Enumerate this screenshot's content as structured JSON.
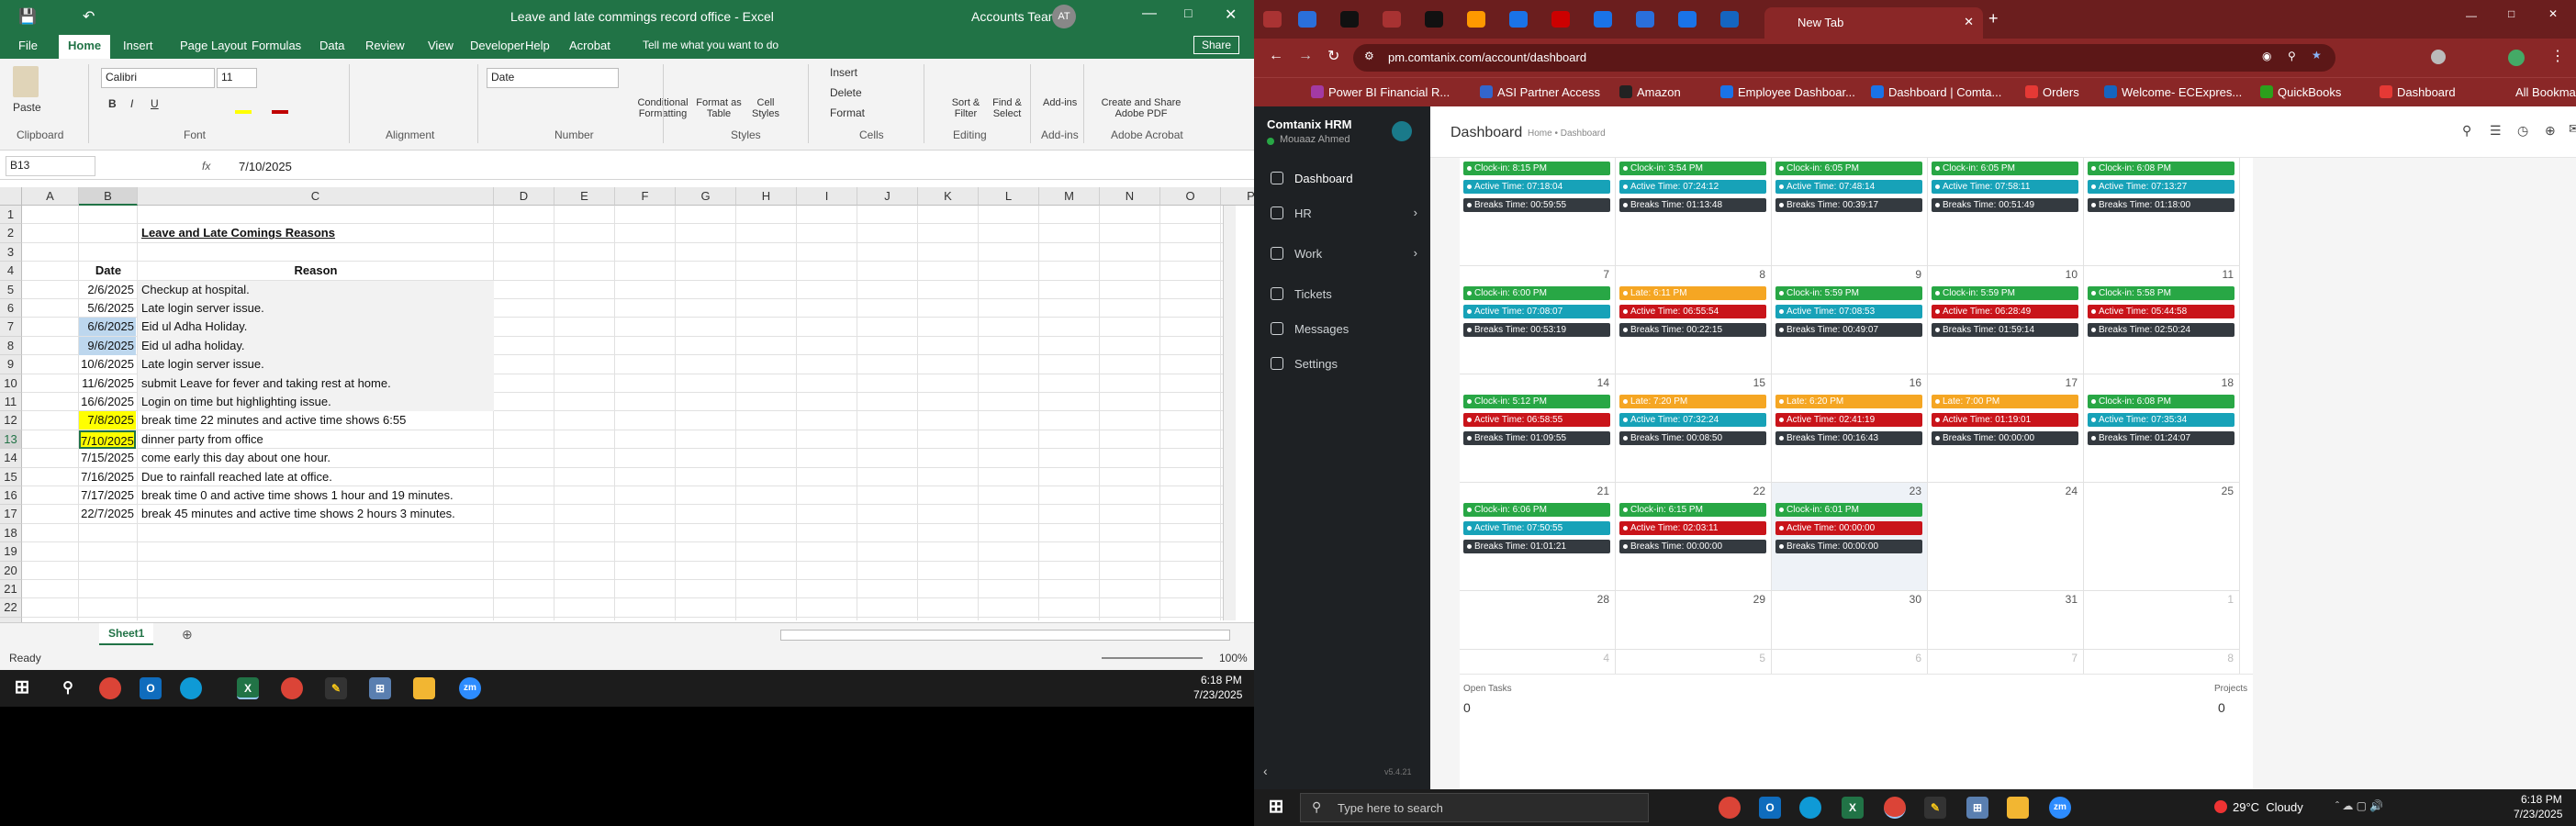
{
  "excel": {
    "title": "Leave and late commings record office  -  Excel",
    "account": "Accounts Team",
    "avatar": "AT",
    "menu": [
      "File",
      "Home",
      "Insert",
      "Page Layout",
      "Formulas",
      "Data",
      "Review",
      "View",
      "Developer",
      "Help",
      "Acrobat"
    ],
    "tell_me": "Tell me what you want to do",
    "share": "Share",
    "ribbon": {
      "font_name": "Calibri",
      "font_size": "11",
      "number_format": "Date",
      "groups": [
        "Clipboard",
        "Font",
        "Alignment",
        "Number",
        "Styles",
        "Cells",
        "Editing",
        "Add-ins",
        "Adobe Acrobat"
      ],
      "buttons": {
        "paste": "Paste",
        "conditional": "Conditional Formatting",
        "format_table": "Format as Table",
        "cell_styles": "Cell Styles",
        "insert": "Insert",
        "delete": "Delete",
        "format": "Format",
        "sort": "Sort & Filter",
        "find": "Find & Select",
        "addins": "Add-ins",
        "create_pdf": "Create and Share Adobe PDF"
      }
    },
    "name_box": "B13",
    "formula": "7/10/2025",
    "fx": "fx",
    "columns": [
      "A",
      "B",
      "C",
      "D",
      "E",
      "F",
      "G",
      "H",
      "I",
      "J",
      "K",
      "L",
      "M",
      "N",
      "O",
      "P"
    ],
    "rows": [
      "1",
      "2",
      "3",
      "4",
      "5",
      "6",
      "7",
      "8",
      "9",
      "10",
      "11",
      "12",
      "13",
      "14",
      "15",
      "16",
      "17",
      "18",
      "19",
      "20",
      "21",
      "22",
      "23"
    ],
    "sheet_title": "Leave and Late Comings Reasons",
    "header_date": "Date",
    "header_reason": "Reason",
    "records": [
      {
        "date": "2/6/2025",
        "reason": "Checkup at hospital."
      },
      {
        "date": "5/6/2025",
        "reason": "Late login server issue."
      },
      {
        "date": "6/6/2025",
        "reason": "Eid ul Adha Holiday."
      },
      {
        "date": "9/6/2025",
        "reason": "Eid ul adha holiday."
      },
      {
        "date": "10/6/2025",
        "reason": "Late login server issue."
      },
      {
        "date": "11/6/2025",
        "reason": "submit Leave for fever and taking rest at  home."
      },
      {
        "date": "16/6/2025",
        "reason": "Login on time but highlighting issue."
      },
      {
        "date": "7/8/2025",
        "reason": "break time 22 minutes and active time shows 6:55"
      },
      {
        "date": "7/10/2025",
        "reason": "dinner party from office"
      },
      {
        "date": "7/15/2025",
        "reason": "come early this day about one hour."
      },
      {
        "date": "7/16/2025",
        "reason": "Due to rainfall reached late at office."
      },
      {
        "date": "7/17/2025",
        "reason": "break time 0 and active time shows 1 hour and 19 minutes."
      },
      {
        "date": "22/7/2025",
        "reason": "break 45 minutes and active time shows 2 hours 3 minutes."
      }
    ],
    "sheet_tab": "Sheet1",
    "status": "Ready",
    "zoom": "100%"
  },
  "taskbar_left": {
    "time": "6:18 PM",
    "date": "7/23/2025"
  },
  "chrome": {
    "tab_title": "New Tab",
    "url": "pm.comtanix.com/account/dashboard",
    "bookmarks": [
      "Power BI Financial R...",
      "ASI Partner Access",
      "Amazon",
      "Employee Dashboar...",
      "Dashboard | Comta...",
      "Orders",
      "Welcome- ECExpres...",
      "QuickBooks",
      "Dashboard"
    ],
    "all_bookmarks": "All Bookmarks"
  },
  "hrm": {
    "brand": "Comtanix HRM",
    "user": "Mouaaz Ahmed",
    "nav": [
      "Dashboard",
      "HR",
      "Work",
      "Tickets",
      "Messages",
      "Settings"
    ],
    "page_title": "Dashboard",
    "breadcrumb": "Home • Dashboard",
    "version": "v5.4.21",
    "open_tasks_label": "Open Tasks",
    "open_tasks": "0",
    "projects_label": "Projects",
    "projects": "0",
    "weeks": [
      {
        "days": [
          {
            "n": "",
            "e": [
              [
                "in",
                "Clock-in: 8:15 PM"
              ],
              [
                "act",
                "Active Time: 07:18:04"
              ],
              [
                "brk",
                "Breaks Time: 00:59:55"
              ]
            ]
          },
          {
            "n": "",
            "e": [
              [
                "in",
                "Clock-in: 3:54 PM"
              ],
              [
                "act",
                "Active Time: 07:24:12"
              ],
              [
                "brk",
                "Breaks Time: 01:13:48"
              ]
            ]
          },
          {
            "n": "",
            "e": [
              [
                "in",
                "Clock-in: 6:05 PM"
              ],
              [
                "act",
                "Active Time: 07:48:14"
              ],
              [
                "brk",
                "Breaks Time: 00:39:17"
              ]
            ]
          },
          {
            "n": "",
            "e": [
              [
                "in",
                "Clock-in: 6:05 PM"
              ],
              [
                "act",
                "Active Time: 07:58:11"
              ],
              [
                "brk",
                "Breaks Time: 00:51:49"
              ]
            ]
          },
          {
            "n": "",
            "e": [
              [
                "in",
                "Clock-in: 6:08 PM"
              ],
              [
                "act",
                "Active Time: 07:13:27"
              ],
              [
                "brk",
                "Breaks Time: 01:18:00"
              ]
            ]
          }
        ]
      },
      {
        "days": [
          {
            "n": "7",
            "e": [
              [
                "in",
                "Clock-in: 6:00 PM"
              ],
              [
                "act",
                "Active Time: 07:08:07"
              ],
              [
                "brk",
                "Breaks Time: 00:53:19"
              ]
            ]
          },
          {
            "n": "8",
            "e": [
              [
                "late",
                "Late: 6:11 PM"
              ],
              [
                "actr",
                "Active Time: 06:55:54"
              ],
              [
                "brk",
                "Breaks Time: 00:22:15"
              ]
            ]
          },
          {
            "n": "9",
            "e": [
              [
                "in",
                "Clock-in: 5:59 PM"
              ],
              [
                "act",
                "Active Time: 07:08:53"
              ],
              [
                "brk",
                "Breaks Time: 00:49:07"
              ]
            ]
          },
          {
            "n": "10",
            "e": [
              [
                "in",
                "Clock-in: 5:59 PM"
              ],
              [
                "actr",
                "Active Time: 06:28:49"
              ],
              [
                "brk",
                "Breaks Time: 01:59:14"
              ]
            ]
          },
          {
            "n": "11",
            "e": [
              [
                "in",
                "Clock-in: 5:58 PM"
              ],
              [
                "actr",
                "Active Time: 05:44:58"
              ],
              [
                "brk",
                "Breaks Time: 02:50:24"
              ]
            ]
          }
        ]
      },
      {
        "days": [
          {
            "n": "14",
            "e": [
              [
                "in",
                "Clock-in: 5:12 PM"
              ],
              [
                "actr",
                "Active Time: 06:58:55"
              ],
              [
                "brk",
                "Breaks Time: 01:09:55"
              ]
            ]
          },
          {
            "n": "15",
            "e": [
              [
                "late",
                "Late: 7:20 PM"
              ],
              [
                "act",
                "Active Time: 07:32:24"
              ],
              [
                "brk",
                "Breaks Time: 00:08:50"
              ]
            ]
          },
          {
            "n": "16",
            "e": [
              [
                "late",
                "Late: 6:20 PM"
              ],
              [
                "actr",
                "Active Time: 02:41:19"
              ],
              [
                "brk",
                "Breaks Time: 00:16:43"
              ]
            ]
          },
          {
            "n": "17",
            "e": [
              [
                "late",
                "Late: 7:00 PM"
              ],
              [
                "actr",
                "Active Time: 01:19:01"
              ],
              [
                "brk",
                "Breaks Time: 00:00:00"
              ]
            ]
          },
          {
            "n": "18",
            "e": [
              [
                "in",
                "Clock-in: 6:08 PM"
              ],
              [
                "act",
                "Active Time: 07:35:34"
              ],
              [
                "brk",
                "Breaks Time: 01:24:07"
              ]
            ]
          }
        ]
      },
      {
        "days": [
          {
            "n": "21",
            "e": [
              [
                "in",
                "Clock-in: 6:06 PM"
              ],
              [
                "act",
                "Active Time: 07:50:55"
              ],
              [
                "brk",
                "Breaks Time: 01:01:21"
              ]
            ]
          },
          {
            "n": "22",
            "e": [
              [
                "in",
                "Clock-in: 6:15 PM"
              ],
              [
                "actr",
                "Active Time: 02:03:11"
              ],
              [
                "brk",
                "Breaks Time: 00:00:00"
              ]
            ]
          },
          {
            "n": "23",
            "e": [
              [
                "in",
                "Clock-in: 6:01 PM"
              ],
              [
                "actr",
                "Active Time: 00:00:00"
              ],
              [
                "brk",
                "Breaks Time: 00:00:00"
              ]
            ]
          },
          {
            "n": "24",
            "e": []
          },
          {
            "n": "25",
            "e": []
          }
        ]
      },
      {
        "days": [
          {
            "n": "28",
            "e": []
          },
          {
            "n": "29",
            "e": []
          },
          {
            "n": "30",
            "e": []
          },
          {
            "n": "31",
            "e": []
          },
          {
            "n": "1",
            "f": true,
            "e": []
          }
        ]
      },
      {
        "days": [
          {
            "n": "4",
            "f": true,
            "e": []
          },
          {
            "n": "5",
            "f": true,
            "e": []
          },
          {
            "n": "6",
            "f": true,
            "e": []
          },
          {
            "n": "7",
            "f": true,
            "e": []
          },
          {
            "n": "8",
            "f": true,
            "e": []
          }
        ]
      }
    ]
  },
  "taskbar_right": {
    "search": "Type here to search",
    "weather": "29°C  Cloudy",
    "time": "6:18 PM",
    "date": "7/23/2025"
  }
}
